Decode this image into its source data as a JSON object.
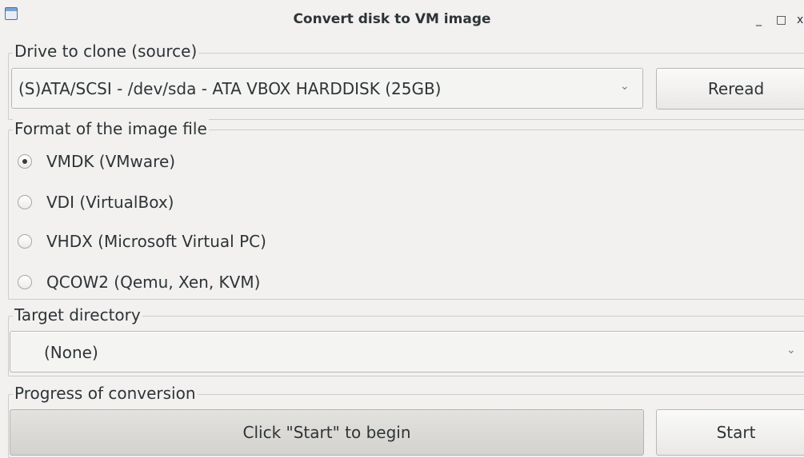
{
  "window": {
    "title": "Convert disk to VM image",
    "min_glyph": "_",
    "max_glyph": "□",
    "close_glyph": "x"
  },
  "source": {
    "legend": "Drive to clone (source)",
    "selected_drive": "(S)ATA/SCSI - /dev/sda - ATA VBOX HARDDISK (25GB)",
    "reread_label": "Reread"
  },
  "format": {
    "legend": "Format of the image file",
    "options": [
      {
        "label": "VMDK (VMware)",
        "checked": true
      },
      {
        "label": "VDI (VirtualBox)",
        "checked": false
      },
      {
        "label": "VHDX (Microsoft Virtual PC)",
        "checked": false
      },
      {
        "label": "QCOW2 (Qemu, Xen, KVM)",
        "checked": false
      }
    ]
  },
  "target": {
    "legend": "Target directory",
    "selected": "(None)"
  },
  "progress": {
    "legend": "Progress of conversion",
    "status_text": "Click \"Start\" to begin",
    "start_label": "Start"
  },
  "icons": {
    "chevron": "⌄"
  }
}
